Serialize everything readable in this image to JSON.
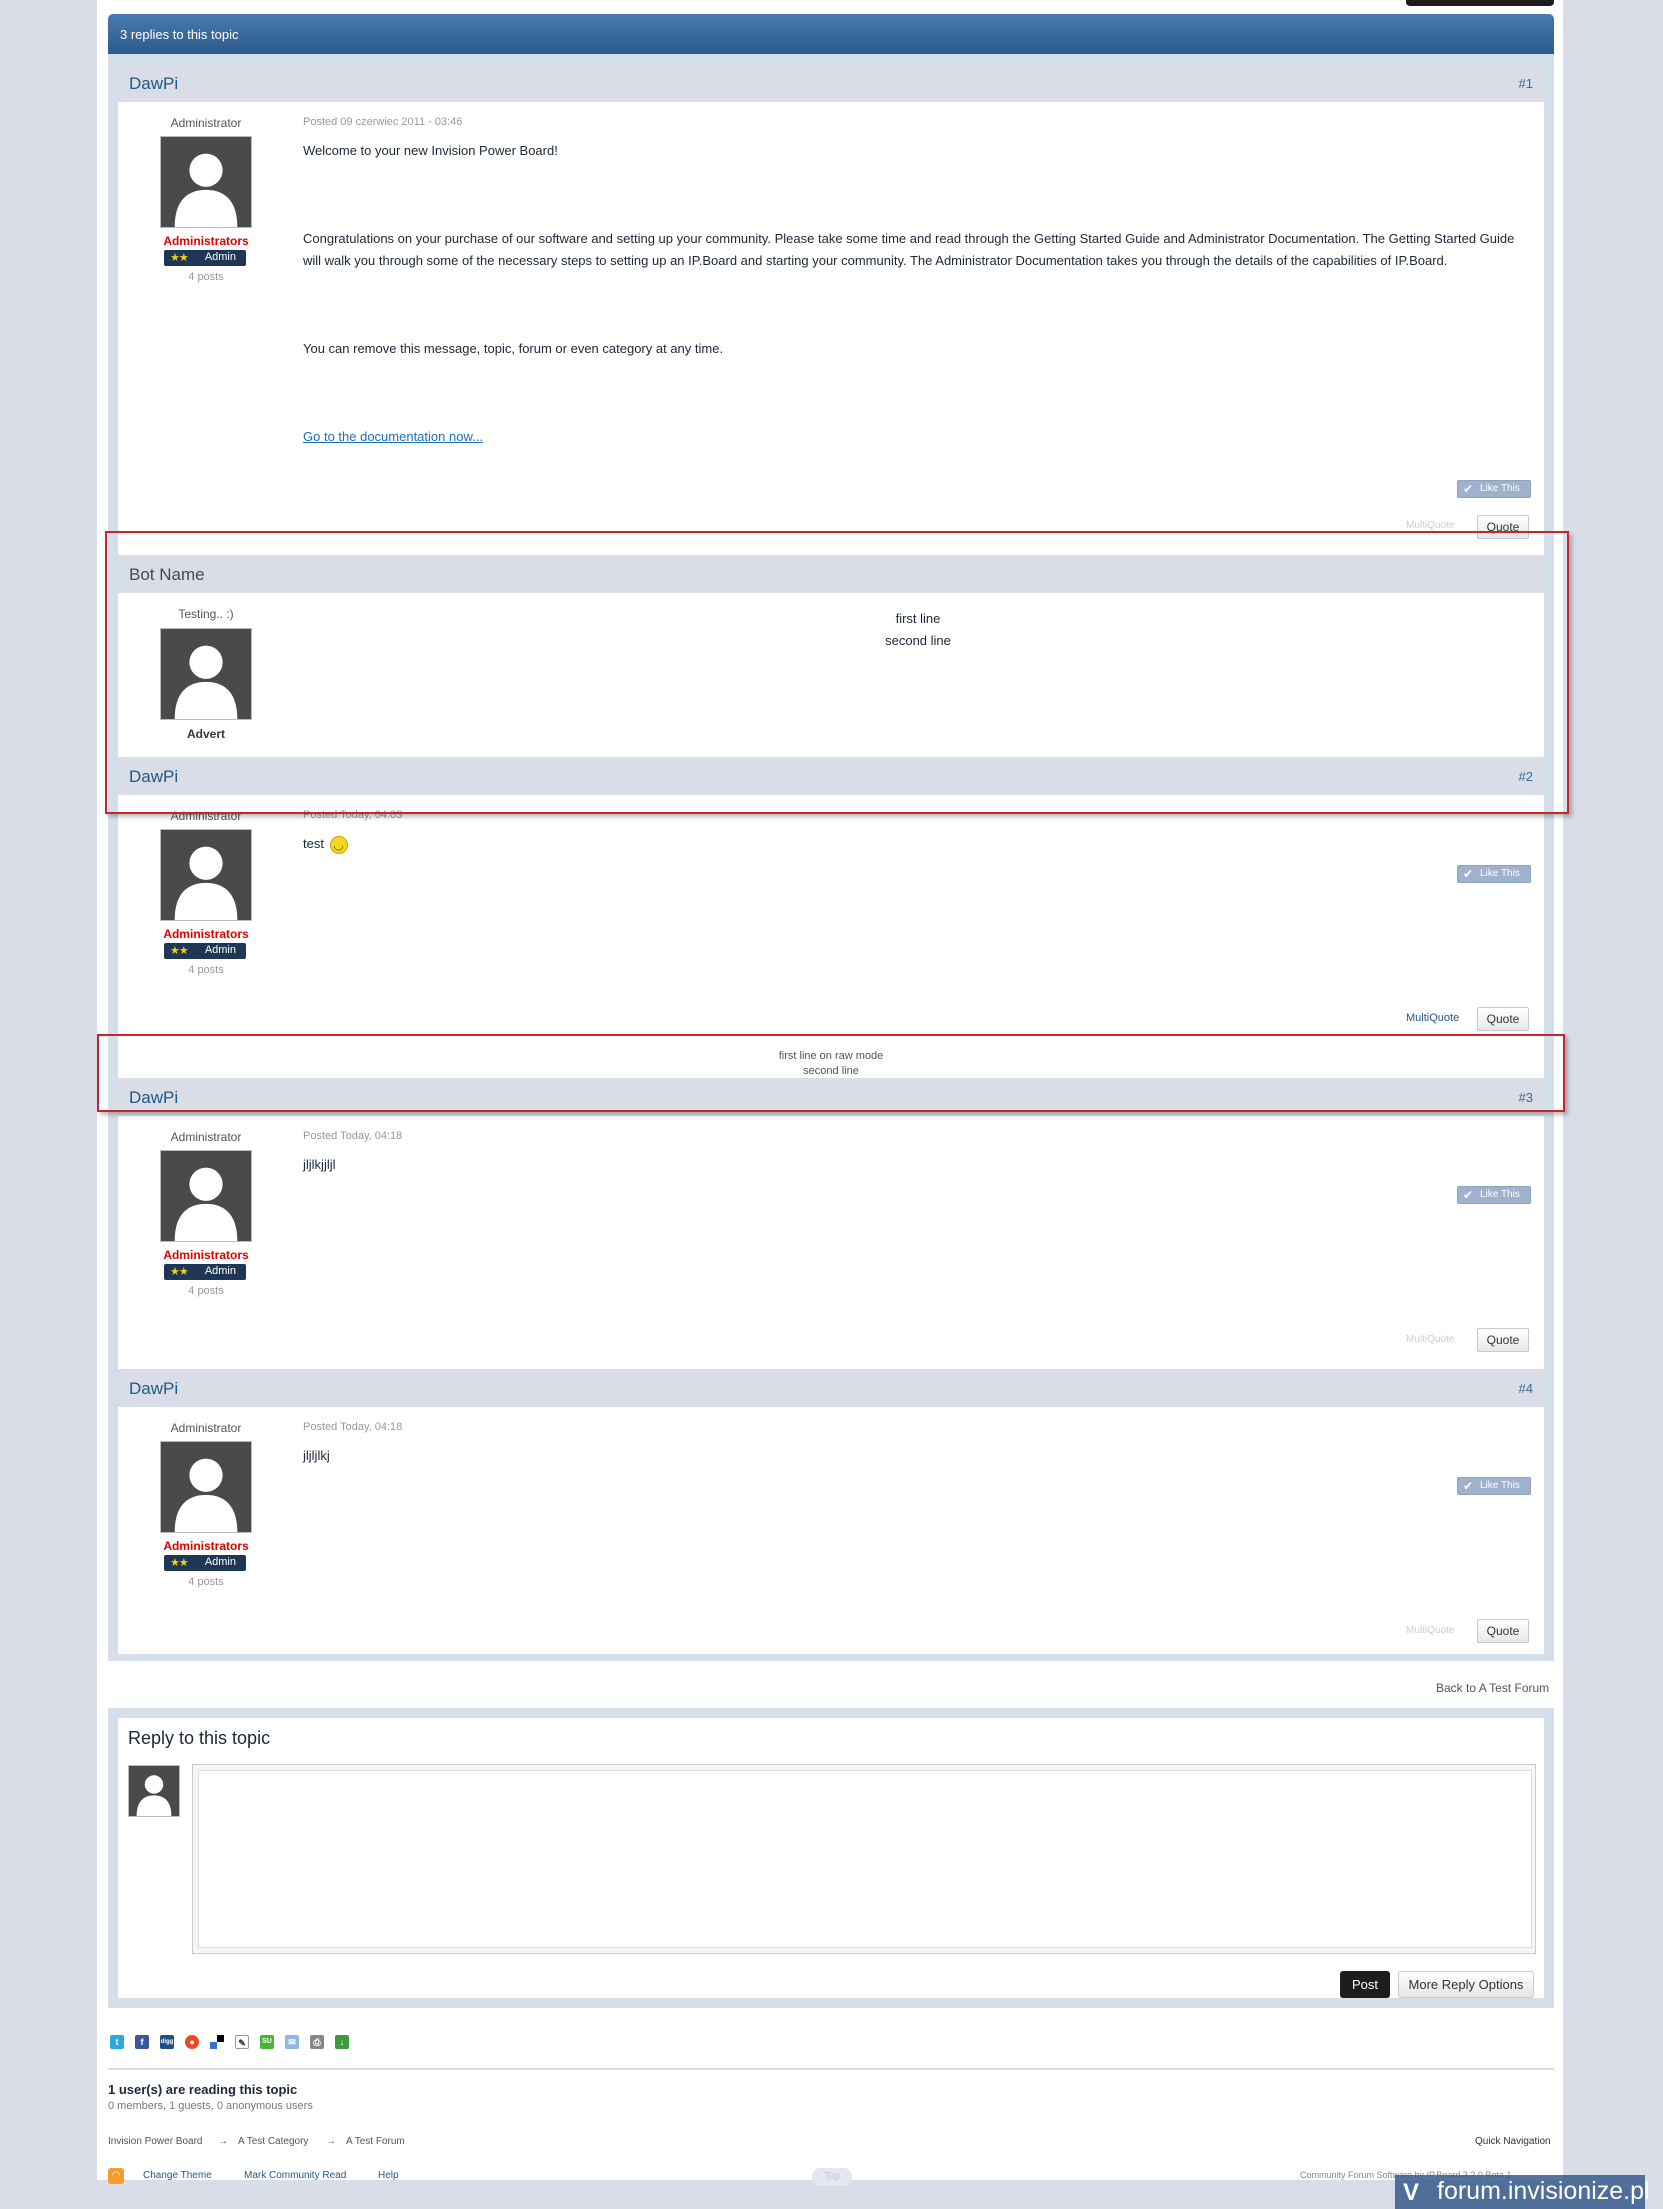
{
  "topic": {
    "replies_title": "3 replies to this topic"
  },
  "posts": [
    {
      "author": "DawPi",
      "number": "#1",
      "title": "Administrator",
      "group": "Administrators",
      "rank_stars": "★★",
      "rank": "Admin",
      "post_count": "4 posts",
      "posted": "Posted 09 czerwiec 2011 - 03:46",
      "paragraphs": [
        "Welcome to your new Invision Power Board!",
        "Congratulations on your purchase of our software and setting up your community. Please take some time and read through the Getting Started Guide and Administrator Documentation. The Getting Started Guide will walk you through some of the necessary steps to setting up an IP.Board and starting your community. The Administrator Documentation takes you through the details of the capabilities of IP.Board.",
        "You can remove this message, topic, forum or even category at any time."
      ],
      "link": "Go to the documentation now...",
      "like": "Like This",
      "multiquote": "MultiQuote",
      "quote": "Quote"
    },
    {
      "author": "DawPi",
      "number": "#2",
      "title": "Administrator",
      "group": "Administrators",
      "rank_stars": "★★",
      "rank": "Admin",
      "post_count": "4 posts",
      "posted": "Posted Today, 04:03",
      "text": "test",
      "like": "Like This",
      "multiquote": "MultiQuote",
      "quote": "Quote"
    },
    {
      "author": "DawPi",
      "number": "#3",
      "title": "Administrator",
      "group": "Administrators",
      "rank_stars": "★★",
      "rank": "Admin",
      "post_count": "4 posts",
      "posted": "Posted Today, 04:18",
      "text": "jljlkjjljl",
      "like": "Like This",
      "multiquote": "MultiQuote",
      "quote": "Quote"
    },
    {
      "author": "DawPi",
      "number": "#4",
      "title": "Administrator",
      "group": "Administrators",
      "rank_stars": "★★",
      "rank": "Admin",
      "post_count": "4 posts",
      "posted": "Posted Today, 04:18",
      "text": "jljljlkj",
      "like": "Like This",
      "multiquote": "MultiQuote",
      "quote": "Quote"
    }
  ],
  "bot": {
    "name": "Bot Name",
    "title": "Testing.. :)",
    "label": "Advert",
    "line1": "first line",
    "line2": "second line"
  },
  "raw": {
    "line1": "first line on raw mode",
    "line2": "second line"
  },
  "back_link": "Back to A Test Forum",
  "reply": {
    "title": "Reply to this topic",
    "post_button": "Post",
    "more_button": "More Reply Options"
  },
  "readers": {
    "title": "1 user(s) are reading this topic",
    "detail": "0 members, 1 guests, 0 anonymous users"
  },
  "breadcrumb": {
    "items": [
      "Invision Power Board",
      "A Test Category",
      "A Test Forum"
    ],
    "separator": "→"
  },
  "quick_navigation": "Quick Navigation",
  "footer": {
    "links": [
      "Change Theme",
      "Mark Community Read",
      "Help"
    ],
    "top": "Top",
    "copyright": "Community Forum Software by IP.Board 3.2.0 Beta 1"
  },
  "watermark": {
    "text": "forum.invisionize.pl"
  },
  "colors": {
    "header_blue": "#2c5a8c",
    "post_head": "#d8dde8",
    "group_red": "#e10000",
    "highlight_red": "#c3262b"
  },
  "share_icons": [
    "twitter-icon",
    "facebook-icon",
    "digg-icon",
    "google-buzz-icon",
    "delicious-icon",
    "reddit-icon",
    "stumbleupon-icon",
    "email-icon",
    "print-icon",
    "download-icon"
  ]
}
